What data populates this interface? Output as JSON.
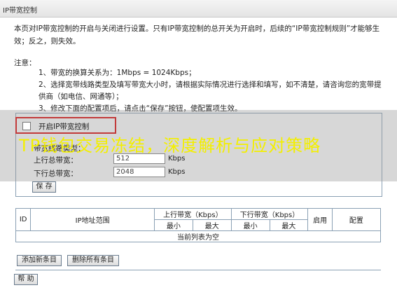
{
  "page": {
    "title": "IP带宽控制",
    "intro": "本页对IP带宽控制的开启与关闭进行设置。只有IP带宽控制的总开关为开启时，后续的“IP带宽控制规则”才能够生效；反之，则失效。",
    "note_title": "注意：",
    "notes": [
      "1、带宽的换算关系为：1Mbps = 1024Kbps；",
      "2、选择宽带线路类型及填写带宽大小时，请根据实际情况进行选择和填写，如不清楚，请咨询您的宽带提供商（如电信、网通等）；",
      "3、修改下面的配置项后，请点击“保存”按钮，使配置项生效。"
    ]
  },
  "overlay": {
    "title": "TP钱包交易冻结，深度解析与应对策略"
  },
  "settings": {
    "enable_label": "开启IP带宽控制",
    "enabled": false,
    "line_type_label": "带宽线路类型：",
    "upload_label": "上行总带宽：",
    "upload_value": "512",
    "download_label": "下行总带宽：",
    "download_value": "2048",
    "unit": "Kbps",
    "save_button": "保 存"
  },
  "rules_table": {
    "col_id": "ID",
    "col_ip_range": "IP地址范围",
    "col_upload": "上行带宽（Kbps）",
    "col_download": "下行带宽（Kbps）",
    "col_min": "最小",
    "col_max": "最大",
    "col_enable": "启用",
    "col_config": "配置",
    "empty_text": "当前列表为空"
  },
  "actions": {
    "add_new": "添加新条目",
    "delete_all": "删除所有条目",
    "help": "帮 助"
  }
}
